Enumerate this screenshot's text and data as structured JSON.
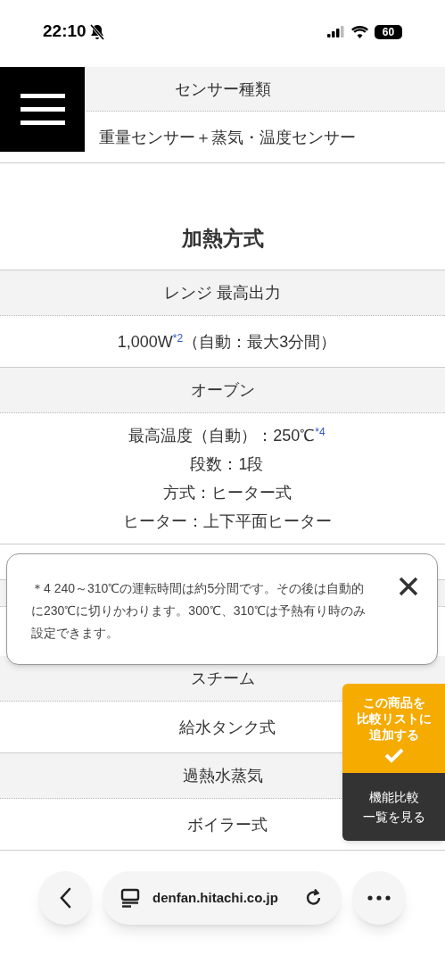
{
  "status_bar": {
    "time": "22:10",
    "silent": true,
    "battery": "60"
  },
  "sections": [
    {
      "rows": [
        {
          "kind": "header",
          "lines": [
            "センサー種類"
          ]
        },
        {
          "kind": "value",
          "lines": [
            "重量センサー＋蒸気・温度センサー"
          ]
        }
      ]
    },
    {
      "title": "加熱方式",
      "rows": [
        {
          "kind": "header",
          "lines": [
            "レンジ 最高出力"
          ]
        },
        {
          "kind": "value",
          "lines": [
            "1,000W$^{*2}$（自動：最大3分間）"
          ]
        },
        {
          "kind": "header",
          "lines": [
            "オーブン"
          ]
        },
        {
          "kind": "value",
          "lines": [
            "最高温度（自動）：250℃$^{*4}$",
            "段数：1段",
            "方式：ヒーター式",
            "ヒーター：上下平面ヒーター"
          ]
        }
      ]
    },
    {
      "rows": [
        {
          "kind": "header",
          "lines": [
            "スチーム"
          ]
        },
        {
          "kind": "value",
          "lines": [
            "給水タンク式"
          ]
        },
        {
          "kind": "header",
          "lines": [
            "過熱水蒸気"
          ]
        },
        {
          "kind": "value",
          "lines": [
            "ボイラー式"
          ]
        }
      ]
    }
  ],
  "footnote_popup": {
    "text": "＊4 240～310℃の運転時間は約5分間です。その後は自動的に230℃に切りかわります。300℃、310℃は予熱有り時のみ設定できます。"
  },
  "compare_panel": {
    "add_button": [
      "この商品を",
      "比較リストに",
      "追加する"
    ],
    "list_button": [
      "機能比較",
      "一覧を見る"
    ]
  },
  "browser_bar": {
    "url": "denfan.hitachi.co.jp"
  }
}
